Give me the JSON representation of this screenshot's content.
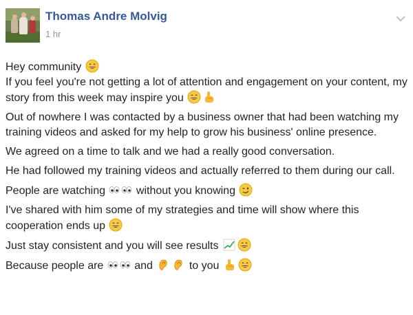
{
  "post": {
    "author": "Thomas Andre Molvig",
    "timestamp": "1 hr",
    "lines": {
      "l1": "Hey community",
      "l2": "If you feel you're not getting a lot of attention and engagement on your content, my story from this week may inspire you",
      "l3": "Out of nowhere I was contacted by a business owner that had been watching my training videos and asked for my help to grow his business' online presence.",
      "l4": "We agreed on a time to talk and we had a really good conversation.",
      "l5": "He had followed my training videos and actually referred to them during our call.",
      "l6a": "People are watching",
      "l6b": "without you knowing",
      "l7": "I've shared with him some of my strategies and time will show where this cooperation ends up",
      "l8": "Just stay consistent and you will see results",
      "l9a": "Because people are",
      "l9b": "and",
      "l9c": "to you"
    },
    "icons": {
      "avatar": "profile-photo",
      "menu": "chevron-down-icon",
      "grin": "grinning-emoji",
      "point": "pointing-hand-emoji",
      "eyes": "eyes-emoji",
      "wink": "winking-emoji",
      "chart": "chart-increasing-emoji",
      "ear": "ear-emoji"
    },
    "colors": {
      "author": "#365899",
      "meta": "#90949c",
      "text": "#1d2129"
    }
  }
}
